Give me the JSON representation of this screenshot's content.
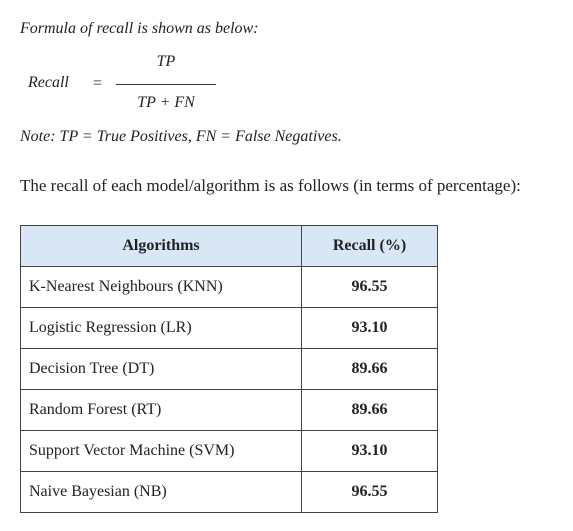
{
  "intro": "Formula of recall is shown as below:",
  "formula": {
    "lhs": "Recall",
    "equals": "=",
    "numerator": "TP",
    "denominator": "TP + FN"
  },
  "note": "Note:  TP = True Positives, FN = False Negatives.",
  "paragraph": "The recall of each model/algorithm is as follows (in terms of percentage):",
  "table": {
    "headers": [
      "Algorithms",
      "Recall (%)"
    ],
    "rows": [
      {
        "algorithm": "K-Nearest Neighbours (KNN)",
        "recall": "96.55"
      },
      {
        "algorithm": "Logistic Regression (LR)",
        "recall": "93.10"
      },
      {
        "algorithm": "Decision Tree (DT)",
        "recall": "89.66"
      },
      {
        "algorithm": "Random Forest (RT)",
        "recall": "89.66"
      },
      {
        "algorithm": "Support Vector Machine (SVM)",
        "recall": "93.10"
      },
      {
        "algorithm": "Naive Bayesian (NB)",
        "recall": "96.55"
      }
    ],
    "header_color": "#d9e6f5"
  }
}
